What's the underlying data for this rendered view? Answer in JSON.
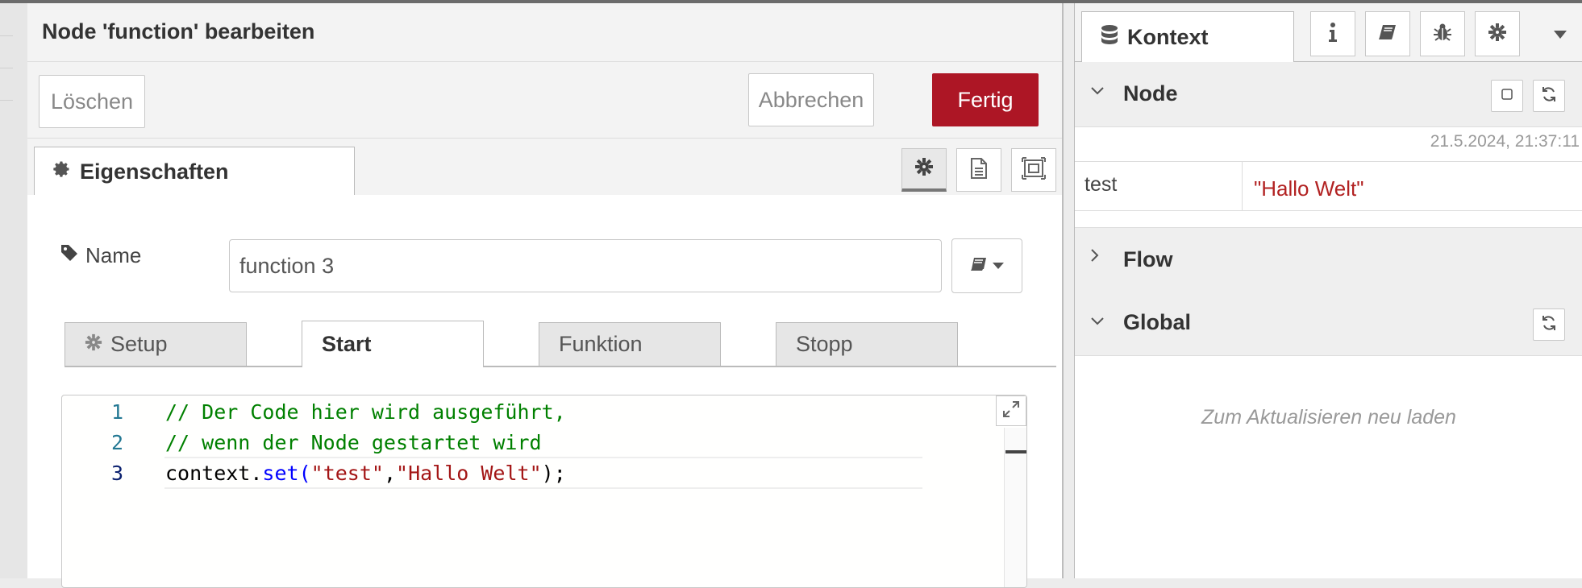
{
  "editor": {
    "title": "Node 'function' bearbeiten",
    "buttons": {
      "delete": "Löschen",
      "cancel": "Abbrechen",
      "done": "Fertig"
    },
    "tab_properties": "Eigenschaften",
    "name_label": "Name",
    "name_value": "function 3",
    "subtabs": [
      "Setup",
      "Start",
      "Funktion",
      "Stopp"
    ],
    "active_subtab": "Start",
    "code": {
      "line_numbers": [
        "1",
        "2",
        "3"
      ],
      "line1": "// Der Code hier wird ausgeführt,",
      "line2": "// wenn der Node gestartet wird",
      "line3": {
        "obj": "context.",
        "fn": "set(",
        "arg1": "\"test\"",
        "comma": ",",
        "arg2": "\"Hallo Welt\"",
        "end": ");"
      }
    }
  },
  "sidebar": {
    "tab": "Kontext",
    "sections": {
      "node": "Node",
      "flow": "Flow",
      "global": "Global"
    },
    "timestamp": "21.5.2024, 21:37:11",
    "entry": {
      "key": "test",
      "value": "\"Hallo Welt\""
    },
    "refresh_hint": "Zum Aktualisieren neu laden"
  },
  "colors": {
    "primary": "#ad1625",
    "string": "#a31515",
    "comment": "#008000",
    "keyword": "#0000ff"
  }
}
